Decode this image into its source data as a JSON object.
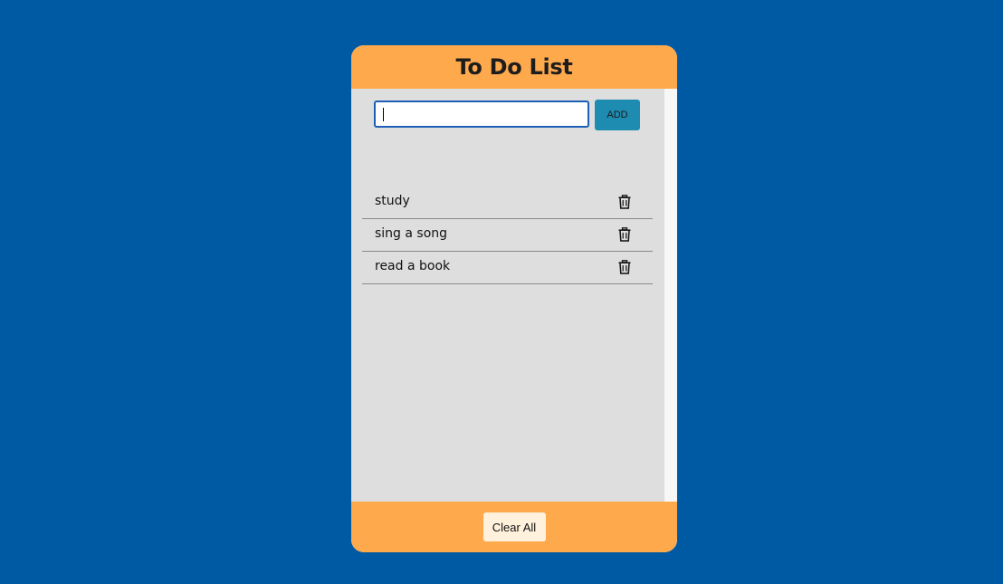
{
  "app": {
    "title": "To Do List"
  },
  "input": {
    "value": "",
    "placeholder": ""
  },
  "add_button": {
    "label": "ADD"
  },
  "todos": [
    {
      "text": "study",
      "icon": "trash-icon"
    },
    {
      "text": "sing a song",
      "icon": "trash-icon"
    },
    {
      "text": "read a book",
      "icon": "trash-icon"
    }
  ],
  "footer": {
    "clear_label": "Clear All"
  },
  "colors": {
    "page_background": "#005aa3",
    "header_footer": "#ffa94d",
    "body": "#dedede",
    "add_button": "#1e8bb0",
    "clear_button": "#fff1dc",
    "input_border": "#1d5fb6"
  }
}
